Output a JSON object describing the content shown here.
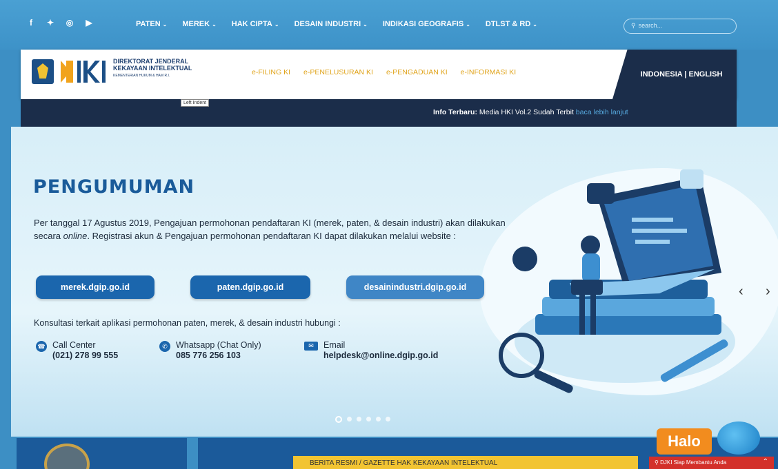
{
  "topbar": {
    "social_icons": [
      {
        "name": "facebook-icon",
        "glyph": "f"
      },
      {
        "name": "twitter-icon",
        "glyph": "✦"
      },
      {
        "name": "instagram-icon",
        "glyph": "◎"
      },
      {
        "name": "youtube-icon",
        "glyph": "▶"
      }
    ],
    "nav": [
      {
        "label": "PATEN",
        "caret": "⌄"
      },
      {
        "label": "MEREK",
        "caret": "⌄"
      },
      {
        "label": "HAK CIPTA",
        "caret": "⌄"
      },
      {
        "label": "DESAIN INDUSTRI",
        "caret": "⌄"
      },
      {
        "label": "INDIKASI GEOGRAFIS",
        "caret": "⌄"
      },
      {
        "label": "DTLST & RD",
        "caret": "⌄"
      }
    ],
    "search_placeholder": "search..."
  },
  "header": {
    "logo_line1": "DIREKTORAT JENDERAL",
    "logo_line2": "KEKAYAAN INTELEKTUAL",
    "logo_line3": "KEMENTERIAN HUKUM & HAM R.I.",
    "ki_nav": [
      "e-FILING KI",
      "e-PENELUSURAN KI",
      "e-PENGADUAN KI",
      "e-INFORMASI KI"
    ],
    "language": "INDONESIA | ENGLISH"
  },
  "infobar": {
    "tooltip": "Left Indent",
    "label": "Info Terbaru:",
    "text": " Media HKI Vol.2 Sudah Terbit ",
    "link": "baca lebih lanjut"
  },
  "hero": {
    "title": "PENGUMUMAN",
    "desc_part1": "Per tanggal 17 Agustus 2019, Pengajuan permohonan pendaftaran KI (merek, paten, & desain industri) akan dilakukan secara ",
    "desc_italic": "online",
    "desc_part2": ". Registrasi akun & Pengajuan permohonan pendaftaran KI dapat dilakukan melalui website :",
    "buttons": [
      "merek.dgip.go.id",
      "paten.dgip.go.id",
      "desainindustri.dgip.go.id"
    ],
    "konsultasi": "Konsultasi terkait aplikasi permohonan paten, merek, & desain industri hubungi :",
    "contacts": [
      {
        "label": "Call Center",
        "value": "(021) 278 99 555"
      },
      {
        "label": "Whatsapp (Chat Only)",
        "value": "085 776 256 103"
      },
      {
        "label": "Email",
        "value": "helpdesk@online.dgip.go.id"
      }
    ],
    "prev_arrow": "‹",
    "next_arrow": "›",
    "slides_total": 6,
    "active_slide": 1
  },
  "bottom": {
    "gazette": "BERITA RESMI / GAZETTE HAK KEKAYAAN INTELEKTUAL",
    "halo": "Halo",
    "help": "DJKI Siap Membantu Anda",
    "help_up": "⌃"
  }
}
